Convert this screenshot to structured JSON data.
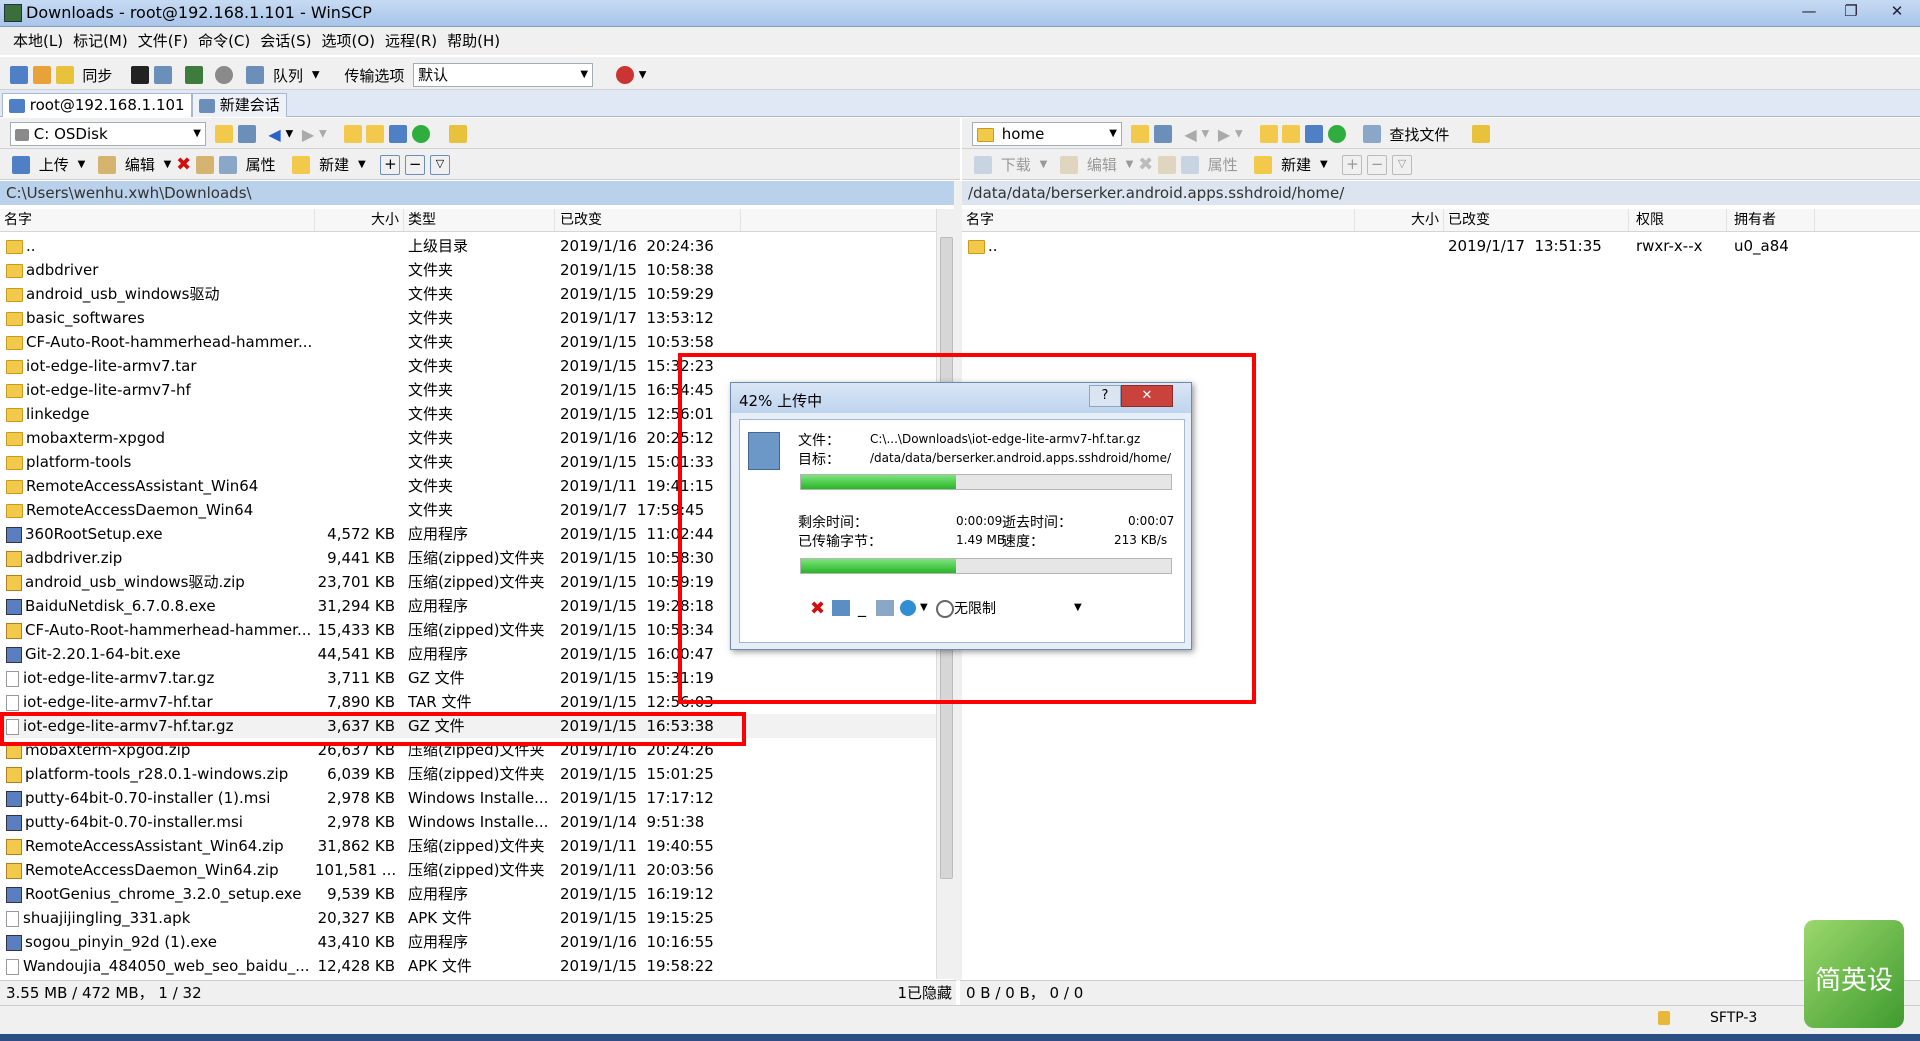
{
  "window": {
    "title": "Downloads - root@192.168.1.101 - WinSCP"
  },
  "menu": [
    "本地(L)",
    "标记(M)",
    "文件(F)",
    "命令(C)",
    "会话(S)",
    "选项(O)",
    "远程(R)",
    "帮助(H)"
  ],
  "toolbar": {
    "sync_label": "同步",
    "queue_label": "队列",
    "transfer_label": "传输选项",
    "transfer_value": "默认"
  },
  "tabs": {
    "session": "root@192.168.1.101",
    "new_session": "新建会话"
  },
  "local": {
    "drive": "C: OSDisk",
    "actions": {
      "upload": "上传",
      "edit": "编辑",
      "props": "属性",
      "new": "新建"
    },
    "path": "C:\\Users\\wenhu.xwh\\Downloads\\",
    "columns": {
      "name": "名字",
      "size": "大小",
      "type": "类型",
      "changed": "已改变"
    },
    "files": [
      {
        "name": "..",
        "size": "",
        "type": "上级目录",
        "changed": "2019/1/16  20:24:36",
        "icon": "up"
      },
      {
        "name": "adbdriver",
        "size": "",
        "type": "文件夹",
        "changed": "2019/1/15  10:58:38",
        "icon": "folder"
      },
      {
        "name": "android_usb_windows驱动",
        "size": "",
        "type": "文件夹",
        "changed": "2019/1/15  10:59:29",
        "icon": "folder"
      },
      {
        "name": "basic_softwares",
        "size": "",
        "type": "文件夹",
        "changed": "2019/1/17  13:53:12",
        "icon": "folder"
      },
      {
        "name": "CF-Auto-Root-hammerhead-hammer...",
        "size": "",
        "type": "文件夹",
        "changed": "2019/1/15  10:53:58",
        "icon": "folder"
      },
      {
        "name": "iot-edge-lite-armv7.tar",
        "size": "",
        "type": "文件夹",
        "changed": "2019/1/15  15:32:23",
        "icon": "folder"
      },
      {
        "name": "iot-edge-lite-armv7-hf",
        "size": "",
        "type": "文件夹",
        "changed": "2019/1/15  16:54:45",
        "icon": "folder"
      },
      {
        "name": "linkedge",
        "size": "",
        "type": "文件夹",
        "changed": "2019/1/15  12:56:01",
        "icon": "folder"
      },
      {
        "name": "mobaxterm-xpgod",
        "size": "",
        "type": "文件夹",
        "changed": "2019/1/16  20:25:12",
        "icon": "folder"
      },
      {
        "name": "platform-tools",
        "size": "",
        "type": "文件夹",
        "changed": "2019/1/15  15:01:33",
        "icon": "folder"
      },
      {
        "name": "RemoteAccessAssistant_Win64",
        "size": "",
        "type": "文件夹",
        "changed": "2019/1/11  19:41:15",
        "icon": "folder"
      },
      {
        "name": "RemoteAccessDaemon_Win64",
        "size": "",
        "type": "文件夹",
        "changed": "2019/1/7  17:59:45",
        "icon": "folder"
      },
      {
        "name": "360RootSetup.exe",
        "size": "4,572 KB",
        "type": "应用程序",
        "changed": "2019/1/15  11:02:44",
        "icon": "exe"
      },
      {
        "name": "adbdriver.zip",
        "size": "9,441 KB",
        "type": "压缩(zipped)文件夹",
        "changed": "2019/1/15  10:58:30",
        "icon": "zip"
      },
      {
        "name": "android_usb_windows驱动.zip",
        "size": "23,701 KB",
        "type": "压缩(zipped)文件夹",
        "changed": "2019/1/15  10:59:19",
        "icon": "zip"
      },
      {
        "name": "BaiduNetdisk_6.7.0.8.exe",
        "size": "31,294 KB",
        "type": "应用程序",
        "changed": "2019/1/15  19:28:18",
        "icon": "exe"
      },
      {
        "name": "CF-Auto-Root-hammerhead-hammer...",
        "size": "15,433 KB",
        "type": "压缩(zipped)文件夹",
        "changed": "2019/1/15  10:53:34",
        "icon": "zip"
      },
      {
        "name": "Git-2.20.1-64-bit.exe",
        "size": "44,541 KB",
        "type": "应用程序",
        "changed": "2019/1/15  16:00:47",
        "icon": "exe"
      },
      {
        "name": "iot-edge-lite-armv7.tar.gz",
        "size": "3,711 KB",
        "type": "GZ 文件",
        "changed": "2019/1/15  15:31:19",
        "icon": "file"
      },
      {
        "name": "iot-edge-lite-armv7-hf.tar",
        "size": "7,890 KB",
        "type": "TAR 文件",
        "changed": "2019/1/15  12:56:03",
        "icon": "file"
      },
      {
        "name": "iot-edge-lite-armv7-hf.tar.gz",
        "size": "3,637 KB",
        "type": "GZ 文件",
        "changed": "2019/1/15  16:53:38",
        "icon": "file",
        "selected": true
      },
      {
        "name": "mobaxterm-xpgod.zip",
        "size": "26,637 KB",
        "type": "压缩(zipped)文件夹",
        "changed": "2019/1/16  20:24:26",
        "icon": "zip"
      },
      {
        "name": "platform-tools_r28.0.1-windows.zip",
        "size": "6,039 KB",
        "type": "压缩(zipped)文件夹",
        "changed": "2019/1/15  15:01:25",
        "icon": "zip"
      },
      {
        "name": "putty-64bit-0.70-installer (1).msi",
        "size": "2,978 KB",
        "type": "Windows Installe...",
        "changed": "2019/1/15  17:17:12",
        "icon": "exe"
      },
      {
        "name": "putty-64bit-0.70-installer.msi",
        "size": "2,978 KB",
        "type": "Windows Installe...",
        "changed": "2019/1/14  9:51:38",
        "icon": "exe"
      },
      {
        "name": "RemoteAccessAssistant_Win64.zip",
        "size": "31,862 KB",
        "type": "压缩(zipped)文件夹",
        "changed": "2019/1/11  19:40:55",
        "icon": "zip"
      },
      {
        "name": "RemoteAccessDaemon_Win64.zip",
        "size": "101,581 ...",
        "type": "压缩(zipped)文件夹",
        "changed": "2019/1/11  20:03:56",
        "icon": "zip"
      },
      {
        "name": "RootGenius_chrome_3.2.0_setup.exe",
        "size": "9,539 KB",
        "type": "应用程序",
        "changed": "2019/1/15  16:19:12",
        "icon": "exe"
      },
      {
        "name": "shuajijingling_331.apk",
        "size": "20,327 KB",
        "type": "APK 文件",
        "changed": "2019/1/15  19:15:25",
        "icon": "file"
      },
      {
        "name": "sogou_pinyin_92d (1).exe",
        "size": "43,410 KB",
        "type": "应用程序",
        "changed": "2019/1/16  10:16:55",
        "icon": "exe"
      },
      {
        "name": "Wandoujia_484050_web_seo_baidu_...",
        "size": "12,428 KB",
        "type": "APK 文件",
        "changed": "2019/1/15  19:58:22",
        "icon": "file"
      }
    ],
    "status": "3.55 MB / 472 MB， 1 / 32",
    "hidden": "1已隐藏"
  },
  "remote": {
    "drive": "home",
    "find_label": "查找文件",
    "actions": {
      "download": "下载",
      "edit": "编辑",
      "props": "属性",
      "new": "新建"
    },
    "path": "/data/data/berserker.android.apps.sshdroid/home/",
    "columns": {
      "name": "名字",
      "size": "大小",
      "changed": "已改变",
      "rights": "权限",
      "owner": "拥有者"
    },
    "files": [
      {
        "name": "..",
        "size": "",
        "changed": "2019/1/17  13:51:35",
        "rights": "rwxr-x--x",
        "owner": "u0_a84"
      }
    ],
    "status": "0 B / 0 B， 0 / 0",
    "protocol": "SFTP-3"
  },
  "dialog": {
    "title": "42% 上传中",
    "file_label": "文件：",
    "file_value": "C:\\...\\Downloads\\iot-edge-lite-armv7-hf.tar.gz",
    "target_label": "目标：",
    "target_value": "/data/data/berserker.android.apps.sshdroid/home/",
    "remaining_label": "剩余时间：",
    "remaining_value": "0:00:09",
    "elapsed_label": "逝去时间：",
    "elapsed_value": "0:00:07",
    "transferred_label": "已传输字节：",
    "transferred_value": "1.49 MB",
    "speed_label": "速度：",
    "speed_value": "213 KB/s",
    "progress_file": 0.42,
    "progress_total": 0.42,
    "speed_limit": "无限制"
  },
  "watermark": {
    "text": "简英设"
  }
}
